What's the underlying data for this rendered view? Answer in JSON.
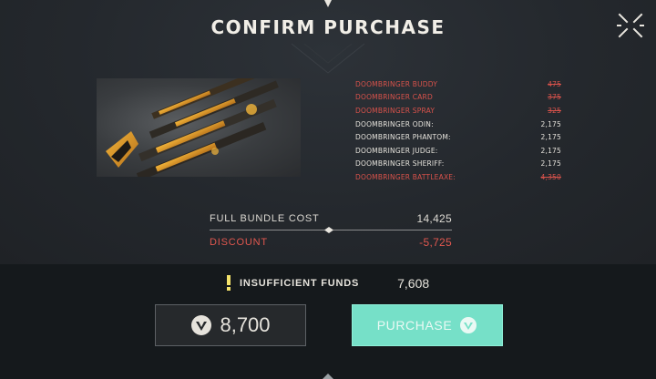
{
  "modal": {
    "title": "CONFIRM PURCHASE"
  },
  "bundle": {
    "items": [
      {
        "name": "DOOMBRINGER BUDDY",
        "price": "475",
        "owned": true
      },
      {
        "name": "DOOMBRINGER CARD",
        "price": "375",
        "owned": true
      },
      {
        "name": "DOOMBRINGER SPRAY",
        "price": "325",
        "owned": true
      },
      {
        "name": "DOOMBRINGER ODIN:",
        "price": "2,175",
        "owned": false
      },
      {
        "name": "DOOMBRINGER PHANTOM:",
        "price": "2,175",
        "owned": false
      },
      {
        "name": "DOOMBRINGER JUDGE:",
        "price": "2,175",
        "owned": false
      },
      {
        "name": "DOOMBRINGER SHERIFF:",
        "price": "2,175",
        "owned": false
      },
      {
        "name": "DOOMBRINGER BATTLEAXE:",
        "price": "4,350",
        "owned": true
      }
    ]
  },
  "summary": {
    "full_cost_label": "FULL BUNDLE COST",
    "full_cost_value": "14,425",
    "discount_label": "DISCOUNT",
    "discount_value": "-5,725"
  },
  "funds": {
    "label": "INSUFFICIENT FUNDS",
    "value": "7,608"
  },
  "buttons": {
    "price_amount": "8,700",
    "purchase_label": "PURCHASE"
  },
  "icons": {
    "close": "close-icon",
    "warning": "warning-icon",
    "currency": "valorant-points-icon"
  },
  "colors": {
    "accent": "#76e0c8",
    "owned_red": "#d8524b",
    "background": "#24282d"
  }
}
